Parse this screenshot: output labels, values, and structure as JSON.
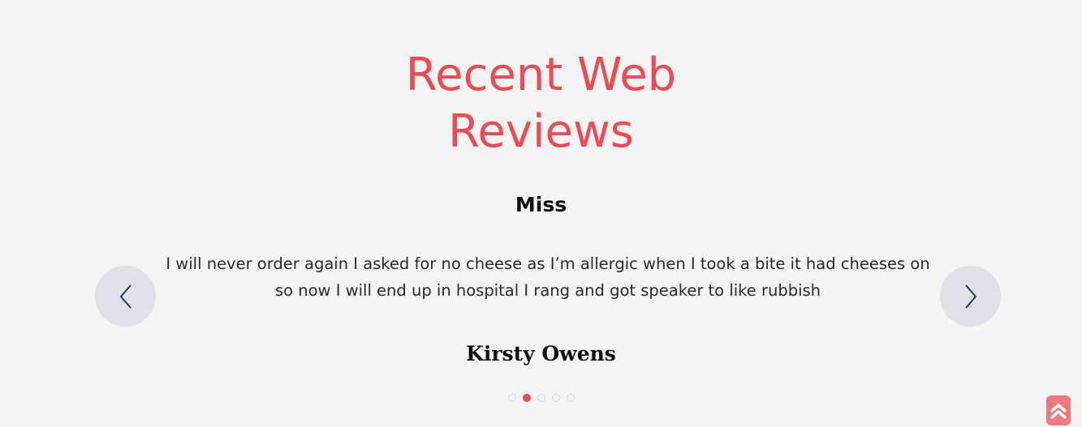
{
  "section": {
    "title_line1": "Recent Web",
    "title_line2": "Reviews"
  },
  "review": {
    "title": "Miss",
    "body": "I will never order again I asked for no cheese as I’m allergic when I took a bite it had cheeses on so now I will end up in hospital I rang and got speaker to like rubbish",
    "reviewer": "Kirsty Owens"
  },
  "carousel": {
    "total_slides": 5,
    "active_slide": 2,
    "prev_icon": "chevron-left-icon",
    "next_icon": "chevron-right-icon"
  },
  "back_to_top": {
    "icon": "double-chevron-up-icon"
  },
  "colors": {
    "accent": "#ee4a52",
    "background": "#f4f4f5",
    "nav_button": "#e0e0e6",
    "nav_icon": "#1e2a5a",
    "back_to_top": "#f0777b"
  }
}
